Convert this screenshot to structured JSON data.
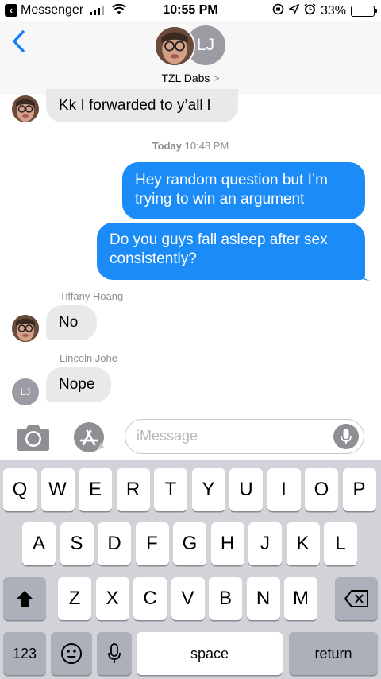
{
  "status_bar": {
    "back_app": "Messenger",
    "time": "10:55 PM",
    "battery": "33%",
    "battery_level": 0.33
  },
  "header": {
    "back_icon": "chevron-left-icon",
    "avatar_initials": "LJ",
    "title": "TZL Dabs",
    "title_chevron": ">"
  },
  "conversation": {
    "messages": [
      {
        "direction": "in",
        "text": "Kk I forwarded to y’all l"
      },
      {
        "direction": "out",
        "text_line1": "Hey random question but I’m",
        "text_line2": "trying to win an argument"
      },
      {
        "direction": "out",
        "text_line1": "Do you guys fall asleep after sex",
        "text_line2": "consistently?"
      },
      {
        "sender": "Tiffany Hoang",
        "direction": "in",
        "text": "No"
      },
      {
        "sender": "Lincoln Johe",
        "direction": "in",
        "text": "Nope",
        "avatar_initials": "LJ"
      }
    ],
    "timestamp_day": "Today",
    "timestamp_time": "10:48 PM"
  },
  "input": {
    "placeholder": "iMessage",
    "camera_icon": "camera-icon",
    "apps_icon": "app-store-icon",
    "mic_icon": "microphone-icon"
  },
  "keyboard": {
    "row1": [
      "Q",
      "W",
      "E",
      "R",
      "T",
      "Y",
      "U",
      "I",
      "O",
      "P"
    ],
    "row2": [
      "A",
      "S",
      "D",
      "F",
      "G",
      "H",
      "J",
      "K",
      "L"
    ],
    "row3": [
      "Z",
      "X",
      "C",
      "V",
      "B",
      "N",
      "M"
    ],
    "numbers_key": "123",
    "space_key": "space",
    "return_key": "return"
  },
  "colors": {
    "outgoing": "#1b8cf7",
    "incoming": "#e9e9eb",
    "accent": "#157efb"
  }
}
